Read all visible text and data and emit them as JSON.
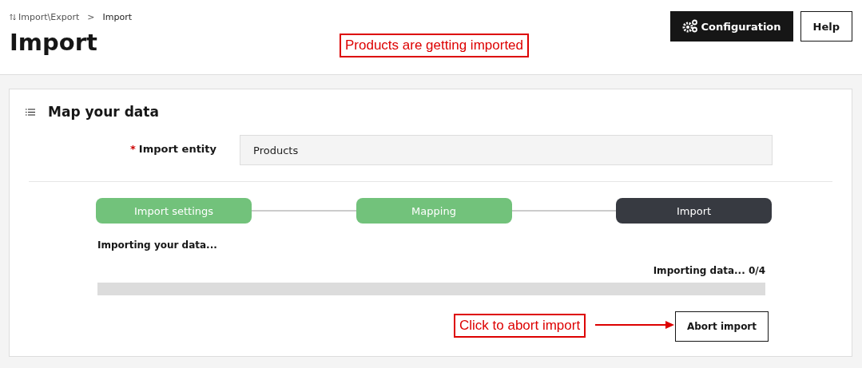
{
  "breadcrumb": {
    "parent": "Import\\Export",
    "separator": ">",
    "current": "Import"
  },
  "title": "Import",
  "header_buttons": [
    {
      "label": "Configuration",
      "kind": "primary"
    },
    {
      "label": "Help",
      "kind": "secondary"
    }
  ],
  "section": {
    "title": "Map your data",
    "field": {
      "required_mark": "*",
      "label": "Import entity",
      "value": "Products"
    },
    "steps": [
      {
        "label": "Import settings",
        "done": true
      },
      {
        "label": "Mapping",
        "done": true
      },
      {
        "label": "Import",
        "done": false
      }
    ],
    "status_text": "Importing your data...",
    "progress": {
      "reading": "Importing data... 0/4",
      "level": 0
    },
    "abort_button": "Abort import"
  },
  "annotations": [
    {
      "text": "Products are getting imported",
      "kind": "plain"
    },
    {
      "text": "Click to abort import",
      "kind": "arrow"
    }
  ]
}
